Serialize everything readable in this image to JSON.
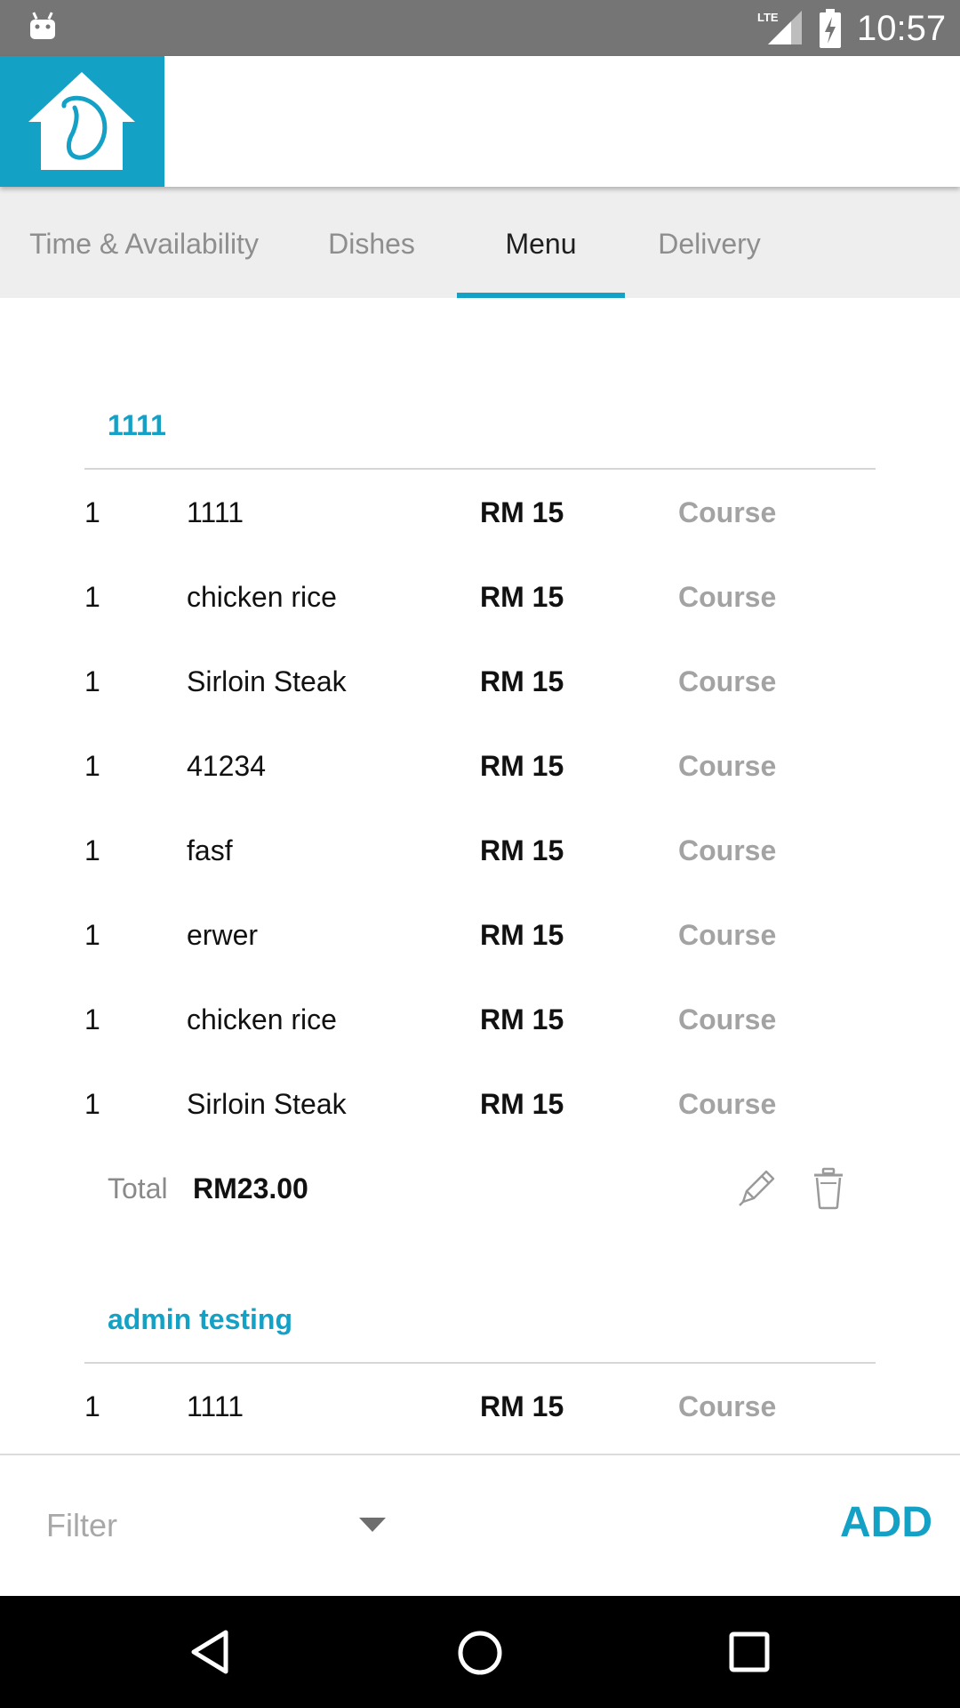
{
  "status_bar": {
    "time": "10:57",
    "network": "LTE"
  },
  "tabs": [
    {
      "label": "Time & Availability",
      "active": false
    },
    {
      "label": "Dishes",
      "active": false
    },
    {
      "label": "Menu",
      "active": true
    },
    {
      "label": "Delivery",
      "active": false
    }
  ],
  "menus": [
    {
      "title": "1111",
      "items": [
        {
          "qty": "1",
          "name": "1111",
          "price": "RM 15",
          "type": "Course"
        },
        {
          "qty": "1",
          "name": "chicken rice",
          "price": "RM 15",
          "type": "Course"
        },
        {
          "qty": "1",
          "name": "Sirloin Steak",
          "price": "RM 15",
          "type": "Course"
        },
        {
          "qty": "1",
          "name": "41234",
          "price": "RM 15",
          "type": "Course"
        },
        {
          "qty": "1",
          "name": "fasf",
          "price": "RM 15",
          "type": "Course"
        },
        {
          "qty": "1",
          "name": "erwer",
          "price": "RM 15",
          "type": "Course"
        },
        {
          "qty": "1",
          "name": "chicken rice",
          "price": "RM 15",
          "type": "Course"
        },
        {
          "qty": "1",
          "name": "Sirloin Steak",
          "price": "RM 15",
          "type": "Course"
        }
      ],
      "total_label": "Total",
      "total_value": "RM23.00"
    },
    {
      "title": "admin testing",
      "items": [
        {
          "qty": "1",
          "name": "1111",
          "price": "RM 15",
          "type": "Course"
        }
      ]
    }
  ],
  "filter": {
    "placeholder": "Filter"
  },
  "add_label": "ADD",
  "colors": {
    "accent": "#14a1c6",
    "status_bar": "#757575",
    "tab_bar": "#eeeeee"
  },
  "icons": [
    "android-icon",
    "lte-signal-icon",
    "battery-charging-icon",
    "app-logo-icon",
    "edit-icon",
    "delete-icon",
    "chevron-down-icon",
    "back-icon",
    "home-icon",
    "recents-icon"
  ]
}
